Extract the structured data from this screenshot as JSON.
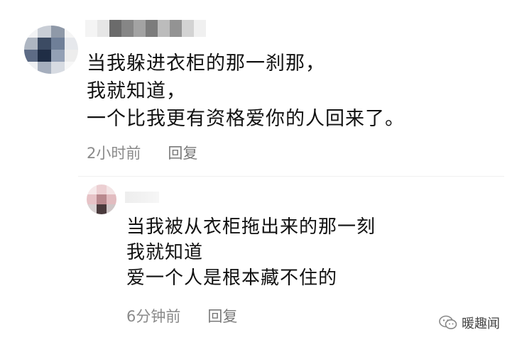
{
  "main_comment": {
    "text_lines": [
      "当我躲进衣柜的那一刹那，",
      "我就知道，",
      "一个比我更有资格爱你的人回来了。"
    ],
    "time": "2小时前",
    "reply_label": "回复"
  },
  "reply_comment": {
    "text_lines": [
      "当我被从衣柜拖出来的那一刻",
      "我就知道",
      "爱一个人是根本藏不住的"
    ],
    "time": "6分钟前",
    "reply_label": "回复"
  },
  "watermark": {
    "text": "暖趣闻",
    "icon": "wechat-icon"
  }
}
